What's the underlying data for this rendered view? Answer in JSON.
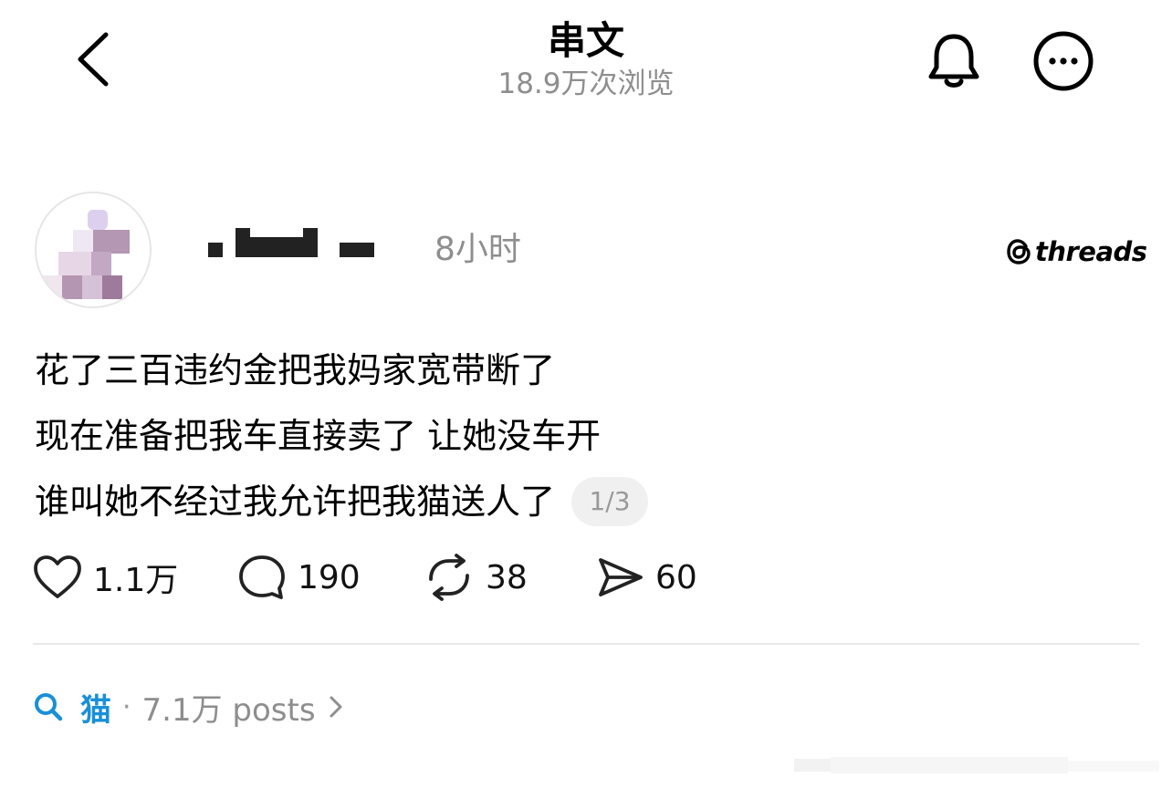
{
  "header": {
    "title": "串文",
    "views": "18.9万次浏览"
  },
  "post": {
    "time": "8小时",
    "brand": "threads",
    "lines": [
      "花了三百违约金把我妈家宽带断了",
      "现在准备把我车直接卖了 让她没车开",
      "谁叫她不经过我允许把我猫送人了"
    ],
    "page_indicator": "1/3",
    "actions": {
      "likes": "1.1万",
      "comments": "190",
      "reposts": "38",
      "shares": "60"
    }
  },
  "topic": {
    "name": "猫",
    "separator": "·",
    "count": "7.1万 posts"
  },
  "icons": {
    "back": "chevron-left-icon",
    "bell": "bell-icon",
    "more": "more-horizontal-icon",
    "brand": "threads-logo-icon",
    "like": "heart-icon",
    "comment": "comment-bubble-icon",
    "repost": "repost-icon",
    "share": "send-icon",
    "search": "search-icon",
    "chevron": "chevron-right-icon"
  },
  "colors": {
    "accent": "#1a8fd8",
    "muted": "#8e8e8e"
  }
}
